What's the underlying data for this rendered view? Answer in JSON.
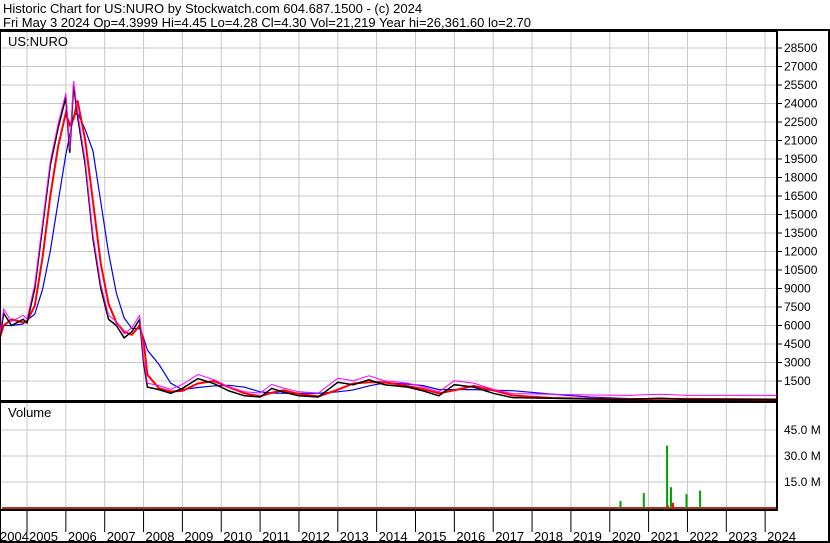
{
  "header": {
    "title": "Historic Chart for US:NURO by Stockwatch.com 604.687.1500 - (c) 2024",
    "quote": "Fri May  3 2024  Op=4.3999  Hi=4.45  Lo=4.28  Cl=4.30  Vol=21,219  Year hi=26,361.60  lo=2.70"
  },
  "chart_data": [
    {
      "type": "line",
      "title": "US:NURO",
      "ylim": [
        0,
        29500
      ],
      "yticks": [
        "28500",
        "27000",
        "25500",
        "24000",
        "22500",
        "21000",
        "19500",
        "18000",
        "16500",
        "15000",
        "13500",
        "12000",
        "10500",
        "9000",
        "7500",
        "6000",
        "4500",
        "3000",
        "1500"
      ],
      "ytick_values": [
        28500,
        27000,
        25500,
        24000,
        22500,
        21000,
        19500,
        18000,
        16500,
        15000,
        13500,
        12000,
        10500,
        9000,
        7500,
        6000,
        4500,
        3000,
        1500
      ],
      "xlim": [
        2004.3,
        2024.4
      ],
      "series": [
        {
          "name": "price",
          "color": "#000000",
          "x": [
            2004.3,
            2004.4,
            2004.6,
            2004.9,
            2005.0,
            2005.2,
            2005.4,
            2005.6,
            2005.8,
            2006.0,
            2006.1,
            2006.2,
            2006.3,
            2006.5,
            2006.7,
            2006.9,
            2007.1,
            2007.3,
            2007.5,
            2007.7,
            2007.9,
            2008.0,
            2008.1,
            2008.4,
            2008.7,
            2009.0,
            2009.4,
            2009.8,
            2010.2,
            2010.6,
            2011.0,
            2011.3,
            2011.6,
            2012.0,
            2012.5,
            2013.0,
            2013.4,
            2013.8,
            2014.2,
            2014.8,
            2015.2,
            2015.6,
            2016.0,
            2016.5,
            2017.0,
            2017.5,
            2018.5,
            2019.5,
            2020.5,
            2021.3,
            2022.0,
            2024.3
          ],
          "y": [
            5000,
            7000,
            6000,
            6500,
            6200,
            9000,
            14000,
            19000,
            22000,
            24500,
            20000,
            25500,
            23000,
            19000,
            13000,
            9000,
            6500,
            6000,
            5000,
            5500,
            6500,
            3000,
            1000,
            800,
            500,
            900,
            1700,
            1300,
            700,
            300,
            200,
            900,
            600,
            300,
            200,
            1400,
            1200,
            1600,
            1200,
            1000,
            700,
            300,
            1200,
            1000,
            500,
            150,
            100,
            40,
            10,
            100,
            10,
            4.3
          ]
        }
      ]
    },
    {
      "type": "bar",
      "title": "Volume",
      "ylim": [
        0,
        52
      ],
      "yticks": [
        "45.0 M",
        "30.0 M",
        "15.0 M"
      ],
      "ytick_values": [
        45,
        30,
        15
      ],
      "x": [
        2020.25,
        2020.85,
        2021.45,
        2021.55,
        2021.95,
        2022.3,
        2021.47,
        2021.6
      ],
      "values": [
        4,
        8.6,
        36,
        12,
        8,
        10,
        1.5,
        3
      ],
      "colors": [
        "#00a000",
        "#00a000",
        "#00a000",
        "#00a000",
        "#00a000",
        "#00a000",
        "#ff0000",
        "#ff0000"
      ]
    }
  ],
  "xaxis": {
    "years": [
      "2004",
      "2005",
      "2006",
      "2007",
      "2008",
      "2009",
      "2010",
      "2011",
      "2012",
      "2013",
      "2014",
      "2015",
      "2016",
      "2017",
      "2018",
      "2019",
      "2020",
      "2021",
      "2022",
      "2023",
      "2024"
    ]
  }
}
